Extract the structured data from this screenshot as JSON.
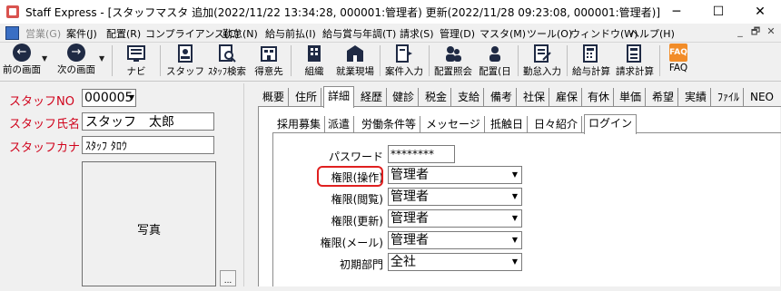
{
  "window": {
    "title": "Staff Express - [スタッフマスタ 追加(2022/11/22 13:34:28, 000001:管理者) 更新(2022/11/28 09:23:08, 000001:管理者)]",
    "controls": [
      "─",
      "☐",
      "✕"
    ]
  },
  "menu": {
    "items": [
      {
        "label": "営業(G)",
        "disabled": true
      },
      {
        "label": "案件(J)"
      },
      {
        "label": "配置(R)"
      },
      {
        "label": "コンプライアンス(C)"
      },
      {
        "label": "勤怠(N)"
      },
      {
        "label": "給与前払(I)"
      },
      {
        "label": "給与賞与年調(T)"
      },
      {
        "label": "請求(S)"
      },
      {
        "label": "管理(D)"
      },
      {
        "label": "マスタ(M)"
      },
      {
        "label": "ツール(O)"
      },
      {
        "label": "ウィンドウ(W)"
      },
      {
        "label": "ヘルプ(H)"
      }
    ],
    "mdi_controls": [
      "_",
      "🗗",
      "✕"
    ]
  },
  "toolbar": {
    "items": [
      {
        "label": "前の画面",
        "icon": "arrow-left-icon"
      },
      {
        "label": "次の画面",
        "icon": "arrow-right-icon"
      },
      {
        "label": "ナビ",
        "icon": "navi-icon"
      },
      {
        "label": "スタッフ",
        "icon": "staff-icon"
      },
      {
        "label": "ｽﾀｯﾌ検索",
        "icon": "staff-search-icon"
      },
      {
        "label": "得意先",
        "icon": "client-icon"
      },
      {
        "label": "組織",
        "icon": "organization-icon"
      },
      {
        "label": "就業現場",
        "icon": "worksite-icon"
      },
      {
        "label": "案件入力",
        "icon": "job-input-icon"
      },
      {
        "label": "配置照会",
        "icon": "placement-inquiry-icon"
      },
      {
        "label": "配置(日",
        "icon": "placement-daily-icon"
      },
      {
        "label": "勤怠入力",
        "icon": "attendance-input-icon"
      },
      {
        "label": "給与計算",
        "icon": "payroll-icon"
      },
      {
        "label": "請求計算",
        "icon": "billing-icon"
      },
      {
        "label": "FAQ",
        "icon": "faq-icon"
      }
    ]
  },
  "staff": {
    "no_label": "スタッフNO",
    "no_value": "000005",
    "name_label": "スタッフ氏名",
    "name_value": "スタッフ　太郎",
    "kana_label": "スタッフカナ",
    "kana_value": "ｽﾀｯﾌ ﾀﾛｳ",
    "photo_label": "写真",
    "photo_side": "..."
  },
  "tabs": [
    "概要",
    "住所",
    "詳細",
    "経歴",
    "健診",
    "税金",
    "支給",
    "備考",
    "社保",
    "雇保",
    "有休",
    "単価",
    "希望",
    "実績",
    "ﾌｧｲﾙ",
    "NEO"
  ],
  "active_tab": "詳細",
  "subtabs": [
    "採用募集",
    "派遣",
    "労働条件等",
    "メッセージ",
    "抵触日",
    "日々紹介",
    "ログイン"
  ],
  "active_subtab": "ログイン",
  "login": {
    "password_label": "パスワード",
    "password_value": "********",
    "fields": [
      {
        "label": "権限(操作)",
        "value": "管理者"
      },
      {
        "label": "権限(閲覧)",
        "value": "管理者"
      },
      {
        "label": "権限(更新)",
        "value": "管理者"
      },
      {
        "label": "権限(メール)",
        "value": "管理者"
      },
      {
        "label": "初期部門",
        "value": "全社"
      }
    ]
  },
  "colors": {
    "accent_red": "#e02020",
    "label_red": "#d0021b"
  }
}
